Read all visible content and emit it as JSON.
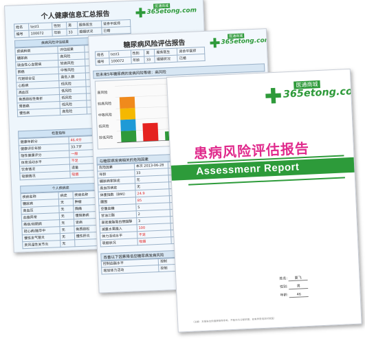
{
  "page1": {
    "title": "个人健康信息汇总报告",
    "logo": {
      "brand": "365etong.com",
      "tag": "医通商城"
    },
    "header_rows": [
      [
        "姓名",
        "test1",
        "性别",
        "男",
        "服务医生",
        "肾余平医师"
      ],
      [
        "编号",
        "100072",
        "年龄",
        "33",
        "婚姻状况",
        "已婚"
      ]
    ],
    "eval_section": "疾病风险评估结果",
    "eval_rows": [
      [
        "疾病种类",
        "评估结果",
        "",
        ""
      ],
      [
        "糖尿病",
        "高风险",
        "",
        ""
      ],
      [
        "缺血性心血管病",
        "较高风险",
        "",
        ""
      ],
      [
        "肺癌",
        "中等风险",
        "",
        ""
      ],
      [
        "代谢综合征",
        "高危人群",
        "",
        ""
      ],
      [
        "心脏病",
        "低风险",
        "",
        ""
      ],
      [
        "高血压",
        "低风险",
        "",
        ""
      ],
      [
        "骨质疏松性骨折",
        "低风险",
        "",
        ""
      ],
      [
        "胃肠癌",
        "低风险",
        "",
        ""
      ],
      [
        "慢性病",
        "高危险",
        "",
        ""
      ]
    ],
    "check_section": "检查指标",
    "check_rows": [
      [
        "健康年龄分",
        "46.4分"
      ],
      [
        "健康评价年龄",
        "33.7岁"
      ],
      [
        "隐性健康评分",
        "一般"
      ],
      [
        "体育活动水平",
        "不足"
      ],
      [
        "饮食情况",
        "适量"
      ],
      [
        "吸烟情况",
        "吸烟"
      ]
    ],
    "history_section": "个人疾病史",
    "history_rows": [
      [
        "疾病名称",
        "病史",
        "疾病名称",
        ""
      ],
      [
        "糖尿病",
        "无",
        "肿瘤",
        ""
      ],
      [
        "高血压",
        "无",
        "胸痛",
        ""
      ],
      [
        "血脂异常",
        "无",
        "慢阻肺病",
        ""
      ],
      [
        "癌症/前期病",
        "无",
        "肾病",
        ""
      ],
      [
        "冠心病/脑卒中",
        "无",
        "骨质疏松",
        ""
      ],
      [
        "慢性支气管炎",
        "无",
        "慢性肝炎",
        ""
      ],
      [
        "类风湿性关节炎",
        "无",
        "",
        ""
      ]
    ]
  },
  "page2": {
    "title": "糖尿病风险评估报告",
    "logo": {
      "brand": "365etong.com",
      "tag": "医通商城"
    },
    "header_rows": [
      [
        "姓名",
        "test1",
        "性别",
        "男",
        "服务医生",
        "肾余平医师"
      ],
      [
        "编号",
        "100072",
        "年龄",
        "33",
        "婚姻状况",
        "已婚"
      ]
    ],
    "risk_heading": "您未来5年糖尿病的发病风险等级：高风险",
    "chart_levels": [
      "高风险",
      "较高风险",
      "中等风险",
      "低风险",
      "较低风险"
    ],
    "side_rows": [
      "高风险",
      "较高风险",
      "中等风险",
      "低风险",
      "较低风险",
      "危险因素",
      "遗传因素",
      "保护因素"
    ],
    "factors_heading": "与糖尿病发病相关的危险因素",
    "factors_rows": [
      [
        "危险因素",
        "本次 2013-06-28",
        "上次"
      ],
      [
        "年龄",
        "33",
        ""
      ],
      [
        "糖尿病家族史",
        "无",
        ""
      ],
      [
        "高血压病史",
        "无",
        ""
      ],
      [
        "体重指数（BMI）",
        "24.9",
        ""
      ],
      [
        "腰围",
        "85",
        ""
      ],
      [
        "空腹血糖",
        "5",
        ""
      ],
      [
        "甘油三酯",
        "2",
        ""
      ],
      [
        "高密度脂蛋白胆固醇",
        "3",
        ""
      ],
      [
        "减重水果摄入",
        "100",
        ""
      ],
      [
        "体力活动水平",
        "不足",
        ""
      ],
      [
        "吸烟状况",
        "吸烟",
        ""
      ]
    ],
    "advice_heading": "改善以下因素降低您糖尿病发病风险",
    "advice_rows": [
      [
        "控制血脂水平",
        "控制"
      ],
      [
        "增加体力活动",
        "控制"
      ]
    ]
  },
  "page3": {
    "logo": {
      "brand": "365etong.com",
      "tag": "医通商城"
    },
    "title_cn": "患病风险评估报告",
    "title_en": "Assessmenr Report",
    "info": [
      {
        "label": "姓名:",
        "value": "夏飞"
      },
      {
        "label": "性别:",
        "value": "男"
      },
      {
        "label": "年龄:",
        "value": "46"
      }
    ],
    "footer": "（注解：本报告仅供健康指导参考，不能作为诊断依据，如有异常请及时就医）"
  },
  "chart_data": {
    "type": "bar",
    "categories": [
      "A",
      "B",
      "C"
    ],
    "series": [
      {
        "values": [
          4,
          1.6,
          0.8
        ]
      }
    ],
    "ylim": [
      0,
      5
    ],
    "colors": {
      "high": "#e52320",
      "mid": "#f5b800",
      "low": "#1e9ad6",
      "lowest": "#2e9a3a"
    }
  }
}
